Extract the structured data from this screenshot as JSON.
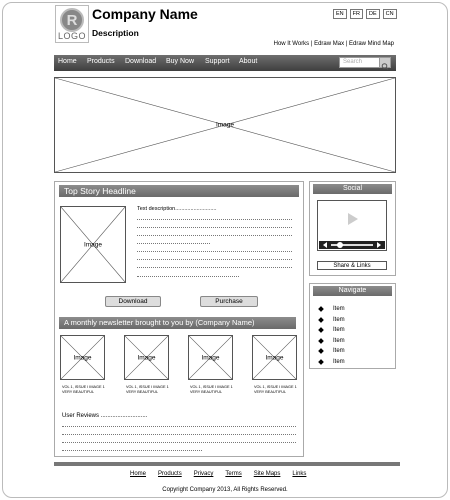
{
  "header": {
    "logo_text": "LOGO",
    "company_name": "Company Name",
    "description": "Description",
    "languages": [
      "EN",
      "FR",
      "DE",
      "CN"
    ],
    "top_links": "How It Works | Edraw Max | Edraw Mind Map"
  },
  "nav": {
    "items": [
      "Home",
      "Products",
      "Download",
      "Buy Now",
      "Support",
      "About"
    ],
    "search_placeholder": "Search"
  },
  "hero": {
    "label": "Image"
  },
  "story": {
    "headline": "Top Story Headline",
    "image_label": "Image",
    "text_description": "Text description...........................",
    "download_label": "Download",
    "purchase_label": "Purchase"
  },
  "newsletter": {
    "title": "A monthly newsletter brought to you by (Company Name)",
    "items": [
      {
        "label": "Image",
        "caption": "VOL 1, ISSUE I IMAGE 1 VERY BEAUTIFUL"
      },
      {
        "label": "Image",
        "caption": "VOL 1, ISSUE I IMAGE 1 VERY BEAUTIFUL"
      },
      {
        "label": "Image",
        "caption": "VOL 1, ISSUE I IMAGE 1 VERY BEAUTIFUL"
      },
      {
        "label": "Image",
        "caption": "VOL 1, ISSUE I IMAGE 1 VERY BEAUTIFUL"
      }
    ],
    "reviews_label": "User Reviews ............................"
  },
  "social": {
    "title": "Social",
    "share_label": "Share & Links"
  },
  "navigate": {
    "title": "Navigate",
    "items": [
      "Item",
      "Item",
      "Item",
      "Item",
      "Item",
      "Item"
    ]
  },
  "footer": {
    "links": [
      "Home",
      "Products",
      "Privacy",
      "Terms",
      "Site Maps",
      "Links"
    ],
    "copyright": "Copyright Company 2013, All Rights Reserved."
  }
}
